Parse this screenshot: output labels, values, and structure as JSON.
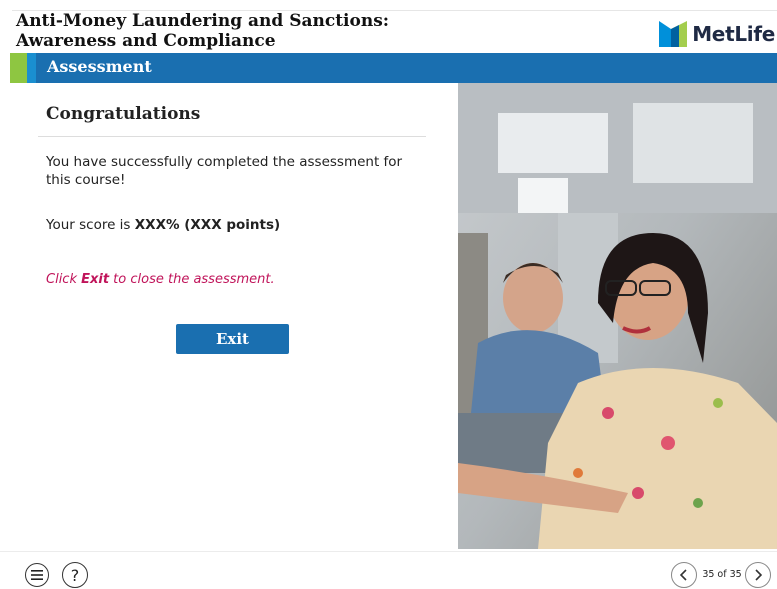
{
  "header": {
    "course_title_line1": "Anti-Money Laundering and Sanctions:",
    "course_title_line2": "Awareness and Compliance",
    "logo_text": "MetLife"
  },
  "section_bar": {
    "title": "Assessment"
  },
  "content": {
    "heading": "Congratulations",
    "completed_text": "You have successfully completed the assessment for this course!",
    "score_prefix": "Your score is ",
    "score_value": "XXX% (XXX points)",
    "instruction_click": "Click ",
    "instruction_exit": "Exit",
    "instruction_rest": " to close the assessment.",
    "exit_button": "Exit"
  },
  "footer": {
    "menu_icon": "menu-icon",
    "help_icon": "help-icon",
    "help_glyph": "?",
    "page_counter": "35 of 35",
    "prev_icon": "chevron-left-icon",
    "next_icon": "chevron-right-icon"
  },
  "colors": {
    "brand_blue": "#1a6fb0",
    "accent_green": "#8ec641",
    "accent_light_blue": "#1a8fd0",
    "instruction_pink": "#c0145a"
  }
}
